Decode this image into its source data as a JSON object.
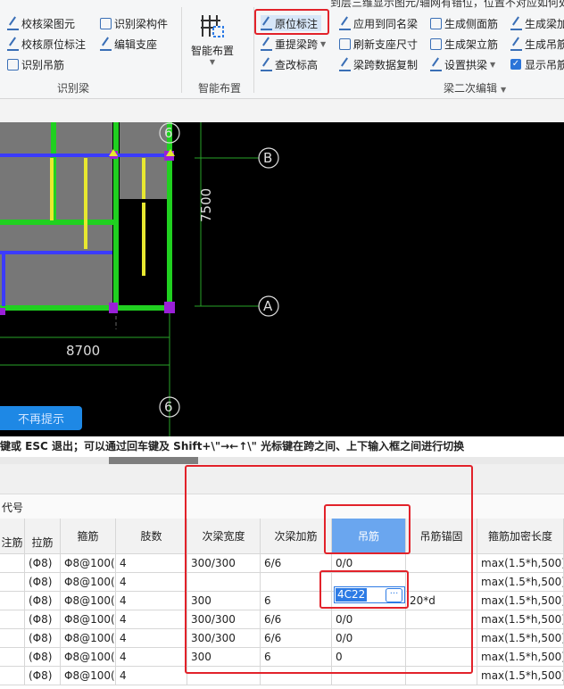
{
  "ribbon": {
    "top_note": "到层三维显示图元/轴网有错位，位置不对应如何处理",
    "col1": [
      "校核梁图元",
      "校核原位标注",
      "识别吊筋"
    ],
    "col2": [
      "识别梁构件",
      "编辑支座"
    ],
    "smart_layout_label": "智能布置",
    "col3": [
      "原位标注",
      "重提梁跨",
      "查改标高"
    ],
    "col4": [
      "应用到同名梁",
      "刷新支座尺寸",
      "梁跨数据复制"
    ],
    "col5": [
      "生成侧面筋",
      "生成架立筋",
      "设置拱梁"
    ],
    "col6": [
      "生成梁加",
      "生成吊筋",
      "显示吊筋"
    ],
    "group_labels": [
      "识别梁",
      "智能布置",
      "梁二次编辑"
    ]
  },
  "canvas": {
    "dims": [
      "7500",
      "8700"
    ],
    "axis_labels": [
      "6",
      "B",
      "A",
      "6"
    ],
    "hint_button": "不再提示"
  },
  "status_text": "键或 ESC 退出；可以通过回车键及 Shift+\\\"→←↑\\\" 光标键在跨之间、上下输入框之间进行切换",
  "props_label": "代号",
  "table": {
    "headers": [
      "注筋",
      "拉筋",
      "箍筋",
      "肢数",
      "次梁宽度",
      "次梁加筋",
      "吊筋",
      "吊筋锚固",
      "箍筋加密长度"
    ],
    "rows": [
      [
        "",
        "(Φ8)",
        "Φ8@100(",
        "4",
        "300/300",
        "6/6",
        "0/0",
        "",
        "max(1.5*h,500)"
      ],
      [
        "",
        "(Φ8)",
        "Φ8@100(",
        "4",
        "",
        "",
        "",
        "",
        "max(1.5*h,500)"
      ],
      [
        "",
        "(Φ8)",
        "Φ8@100(",
        "4",
        "300",
        "6",
        "4C22",
        "20*d",
        "max(1.5*h,500)"
      ],
      [
        "",
        "(Φ8)",
        "Φ8@100(",
        "4",
        "300/300",
        "6/6",
        "0/0",
        "",
        "max(1.5*h,500)"
      ],
      [
        "",
        "(Φ8)",
        "Φ8@100(",
        "4",
        "300/300",
        "6/6",
        "0/0",
        "",
        "max(1.5*h,500)"
      ],
      [
        "",
        "(Φ8)",
        "Φ8@100(",
        "4",
        "300",
        "6",
        "0",
        "",
        "max(1.5*h,500)"
      ],
      [
        "",
        "(Φ8)",
        "Φ8@100(",
        "4",
        "",
        "",
        "",
        "",
        "max(1.5*h,500)"
      ]
    ],
    "edit_more": "···"
  },
  "colors": {
    "highlight": "#e2222a",
    "selected_header": "#6aa6ef",
    "accent": "#2d7be5"
  }
}
